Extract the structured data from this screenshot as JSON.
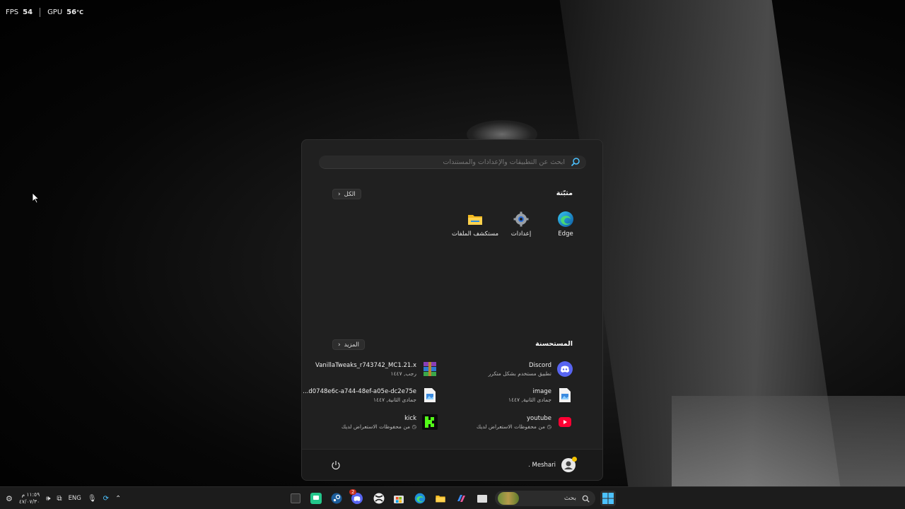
{
  "overlay": {
    "fps_label": "FPS",
    "fps_value": "54",
    "gpu_label": "GPU",
    "gpu_value": "56",
    "gpu_unit": "°C"
  },
  "start_menu": {
    "search_placeholder": "ابحث عن التطبيقات والإعدادات والمستندات",
    "pinned_title": "مثبّتة",
    "all_button": "الكل",
    "pinned_apps": [
      {
        "label": "Edge",
        "icon": "edge-icon"
      },
      {
        "label": "إعدادات",
        "icon": "gear-icon"
      },
      {
        "label": "مستكشف الملفات",
        "icon": "folder-icon"
      }
    ],
    "recommended_title": "المستحسنة",
    "more_button": "المزيد",
    "recommended": [
      {
        "title": "Discord",
        "subtitle": "تطبيق مستخدم بشكل متكرر",
        "icon": "discord-icon"
      },
      {
        "title": "VanillaTweaks_r743742_MC1.21.x",
        "subtitle": "رجب, ١٤٤٧",
        "icon": "winrar-icon"
      },
      {
        "title": "image",
        "subtitle": "جمادى الثانية, ١٤٤٧",
        "icon": "image-file-icon"
      },
      {
        "title": "d0748e6c-a744-48ef-a05e-dc2e75e...",
        "subtitle": "جمادى الثانية, ١٤٤٧",
        "icon": "image-file-icon"
      },
      {
        "title": "youtube",
        "subtitle": "من محفوظات الاستعراض لديك",
        "icon": "youtube-icon"
      },
      {
        "title": "kick",
        "subtitle": "من محفوظات الاستعراض لديك",
        "icon": "kick-icon"
      }
    ],
    "user_name": "Meshari ."
  },
  "taskbar": {
    "search_label": "بحث",
    "lang": "ENG",
    "time": "١١:٥٩ م",
    "date": "٤٧/٠٧/٣٠",
    "steam_badge": "2"
  },
  "colors": {
    "accent": "#4cc2ff",
    "menu_bg": "#202020",
    "taskbar_bg": "#1c1c1c"
  }
}
